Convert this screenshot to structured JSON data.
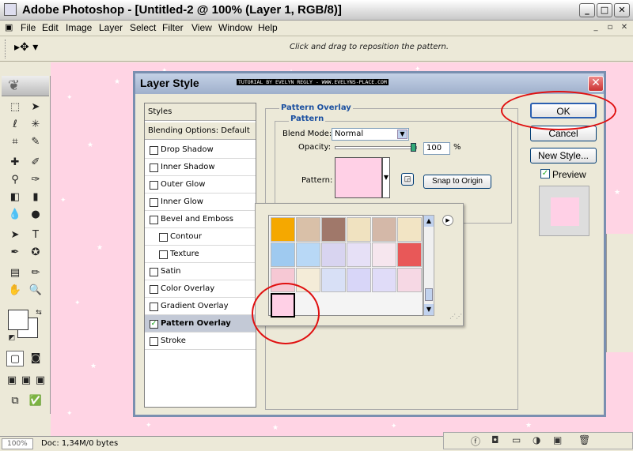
{
  "window": {
    "title": "Adobe Photoshop - [Untitled-2 @ 100% (Layer 1, RGB/8)]"
  },
  "menu": [
    "File",
    "Edit",
    "Image",
    "Layer",
    "Select",
    "Filter",
    "View",
    "Window",
    "Help"
  ],
  "options": {
    "hint": "Click and drag to reposition the pattern."
  },
  "status": {
    "zoom": "100%",
    "doc": "Doc: 1,34M/0 bytes"
  },
  "dialog": {
    "title": "Layer Style",
    "credit": "TUTORIAL BY EVELYN REGLY - WWW.EVELYNS-PLACE.COM",
    "styles": [
      {
        "label": "Styles",
        "type": "head"
      },
      {
        "label": "Blending Options: Default",
        "type": "head"
      },
      {
        "label": "Drop Shadow",
        "checked": false
      },
      {
        "label": "Inner Shadow",
        "checked": false
      },
      {
        "label": "Outer Glow",
        "checked": false
      },
      {
        "label": "Inner Glow",
        "checked": false
      },
      {
        "label": "Bevel and Emboss",
        "checked": false
      },
      {
        "label": "Contour",
        "checked": false,
        "indent": true
      },
      {
        "label": "Texture",
        "checked": false,
        "indent": true
      },
      {
        "label": "Satin",
        "checked": false
      },
      {
        "label": "Color Overlay",
        "checked": false
      },
      {
        "label": "Gradient Overlay",
        "checked": false
      },
      {
        "label": "Pattern Overlay",
        "checked": true,
        "selected": true
      },
      {
        "label": "Stroke",
        "checked": false
      }
    ],
    "section_title": "Pattern Overlay",
    "group_title": "Pattern",
    "blend_mode_label": "Blend Mode:",
    "blend_mode_value": "Normal",
    "opacity_label": "Opacity:",
    "opacity_value": "100",
    "opacity_unit": "%",
    "opacity_level": 1.0,
    "pattern_label": "Pattern:",
    "snap_button": "Snap to Origin",
    "ok": "OK",
    "cancel": "Cancel",
    "new_style": "New Style...",
    "preview_label": "Preview",
    "preview_checked": true
  },
  "patterns": [
    {
      "color": "#f5a800"
    },
    {
      "color": "#d9c0a8"
    },
    {
      "color": "#a0786a"
    },
    {
      "color": "#f0e2c0"
    },
    {
      "color": "#d4b8a8"
    },
    {
      "color": "#f2e4c4"
    },
    {
      "color": "#9fcaf0"
    },
    {
      "color": "#b8d8f6"
    },
    {
      "color": "#d8d4f0"
    },
    {
      "color": "#e6e0f6"
    },
    {
      "color": "#f6e6ee"
    },
    {
      "color": "#e85858"
    },
    {
      "color": "#f6c8d4"
    },
    {
      "color": "#f4ecd8"
    },
    {
      "color": "#d8e0f6"
    },
    {
      "color": "#d8d6f8"
    },
    {
      "color": "#e0dcf8"
    },
    {
      "color": "#f6d8e4"
    },
    {
      "color": "#ffd0e6",
      "selected": true
    }
  ]
}
